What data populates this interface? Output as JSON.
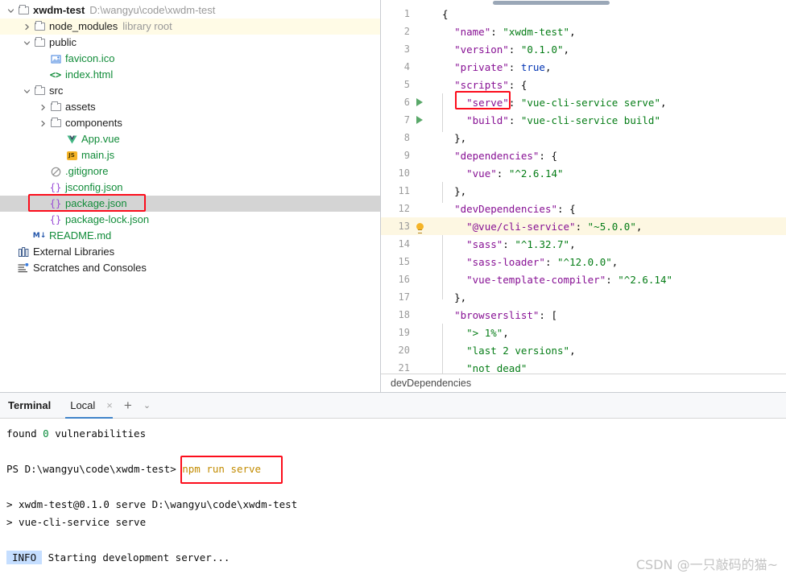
{
  "project_tree": {
    "rows": [
      {
        "indent": 0,
        "arrow": "chevron-down",
        "icon": "folder",
        "label": "xwdm-test",
        "hint": "D:\\wangyu\\code\\xwdm-test",
        "bold": true,
        "state": "normal"
      },
      {
        "indent": 1,
        "arrow": "chevron-right",
        "icon": "folder",
        "label": "node_modules",
        "hint": "library root",
        "bold": false,
        "state": "library"
      },
      {
        "indent": 1,
        "arrow": "chevron-down",
        "icon": "folder",
        "label": "public",
        "hint": "",
        "bold": false,
        "state": "normal"
      },
      {
        "indent": 2,
        "arrow": "none",
        "icon": "image-file",
        "label": "favicon.ico",
        "hint": "",
        "bold": false,
        "state": "normal"
      },
      {
        "indent": 2,
        "arrow": "none",
        "icon": "html-file",
        "label": "index.html",
        "hint": "",
        "bold": false,
        "state": "normal"
      },
      {
        "indent": 1,
        "arrow": "chevron-down",
        "icon": "folder",
        "label": "src",
        "hint": "",
        "bold": false,
        "state": "normal"
      },
      {
        "indent": 2,
        "arrow": "chevron-right",
        "icon": "folder",
        "label": "assets",
        "hint": "",
        "bold": false,
        "state": "normal"
      },
      {
        "indent": 2,
        "arrow": "chevron-right",
        "icon": "folder",
        "label": "components",
        "hint": "",
        "bold": false,
        "state": "normal"
      },
      {
        "indent": 3,
        "arrow": "none",
        "icon": "vue-file",
        "label": "App.vue",
        "hint": "",
        "bold": false,
        "state": "normal"
      },
      {
        "indent": 3,
        "arrow": "none",
        "icon": "js-file",
        "label": "main.js",
        "hint": "",
        "bold": false,
        "state": "normal"
      },
      {
        "indent": 2,
        "arrow": "none",
        "icon": "gitignore-file",
        "label": ".gitignore",
        "hint": "",
        "bold": false,
        "state": "normal"
      },
      {
        "indent": 2,
        "arrow": "none",
        "icon": "json-file",
        "label": "jsconfig.json",
        "hint": "",
        "bold": false,
        "state": "normal"
      },
      {
        "indent": 2,
        "arrow": "none",
        "icon": "json-file",
        "label": "package.json",
        "hint": "",
        "bold": false,
        "state": "selected"
      },
      {
        "indent": 2,
        "arrow": "none",
        "icon": "json-file",
        "label": "package-lock.json",
        "hint": "",
        "bold": false,
        "state": "normal"
      },
      {
        "indent": 1,
        "arrow": "none",
        "icon": "markdown-file",
        "label": "README.md",
        "hint": "",
        "bold": false,
        "state": "normal"
      },
      {
        "indent": 0,
        "arrow": "none",
        "icon": "external-libraries",
        "label": "External Libraries",
        "hint": "",
        "bold": false,
        "state": "normal"
      },
      {
        "indent": 0,
        "arrow": "none",
        "icon": "scratches",
        "label": "Scratches and Consoles",
        "hint": "",
        "bold": false,
        "state": "normal"
      }
    ]
  },
  "editor": {
    "filename": "package.json",
    "status_bar": "devDependencies",
    "lines": [
      {
        "num": "1",
        "marker": "none",
        "text": "{"
      },
      {
        "num": "2",
        "marker": "none",
        "text": "  \"name\": \"xwdm-test\","
      },
      {
        "num": "3",
        "marker": "none",
        "text": "  \"version\": \"0.1.0\","
      },
      {
        "num": "4",
        "marker": "none",
        "text": "  \"private\": true,"
      },
      {
        "num": "5",
        "marker": "none",
        "text": "  \"scripts\": {"
      },
      {
        "num": "6",
        "marker": "run",
        "text": "    \"serve\": \"vue-cli-service serve\","
      },
      {
        "num": "7",
        "marker": "run",
        "text": "    \"build\": \"vue-cli-service build\""
      },
      {
        "num": "8",
        "marker": "none",
        "text": "  },"
      },
      {
        "num": "9",
        "marker": "none",
        "text": "  \"dependencies\": {"
      },
      {
        "num": "10",
        "marker": "none",
        "text": "    \"vue\": \"^2.6.14\""
      },
      {
        "num": "11",
        "marker": "none",
        "text": "  },"
      },
      {
        "num": "12",
        "marker": "none",
        "text": "  \"devDependencies\": {"
      },
      {
        "num": "13",
        "marker": "bulb",
        "text": "    \"@vue/cli-service\": \"~5.0.0\","
      },
      {
        "num": "14",
        "marker": "none",
        "text": "    \"sass\": \"^1.32.7\","
      },
      {
        "num": "15",
        "marker": "none",
        "text": "    \"sass-loader\": \"^12.0.0\","
      },
      {
        "num": "16",
        "marker": "none",
        "text": "    \"vue-template-compiler\": \"^2.6.14\""
      },
      {
        "num": "17",
        "marker": "none",
        "text": "  },"
      },
      {
        "num": "18",
        "marker": "none",
        "text": "  \"browserslist\": ["
      },
      {
        "num": "19",
        "marker": "none",
        "text": "    \"> 1%\","
      },
      {
        "num": "20",
        "marker": "none",
        "text": "    \"last 2 versions\","
      },
      {
        "num": "21",
        "marker": "none",
        "text": "    \"not dead\""
      }
    ]
  },
  "terminal": {
    "title": "Terminal",
    "tab_label": "Local",
    "close_icon": "×",
    "plus_icon": "+",
    "chevron_icon": "⌄",
    "lines": {
      "found_prefix": "found ",
      "found_zero": "0",
      "found_suffix": " vulnerabilities",
      "prompt": "PS D:\\wangyu\\code\\xwdm-test>",
      "command": "npm run serve",
      "out1": "> xwdm-test@0.1.0 serve D:\\wangyu\\code\\xwdm-test",
      "out2": "> vue-cli-service serve",
      "info_badge": "INFO",
      "info_text": "Starting development server..."
    }
  },
  "annotations": {
    "highlight_color": "#fc0d1c",
    "boxes": [
      "package.json",
      "\"serve\"",
      "npm run serve"
    ]
  },
  "watermark": {
    "text": "CSDN @一只敲码的猫~"
  }
}
